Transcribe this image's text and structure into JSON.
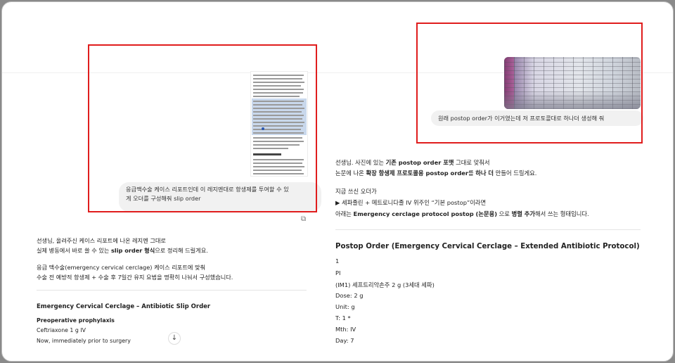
{
  "left_chat": {
    "user_message_line1": "응급맥수술 케이스 리포트인데 이 레지멘대로 항생제를 투여할 수 있",
    "user_message_line2": "게 오더를 구성해줘 slip order",
    "reply_p1_line1": "선생님, 올려주신 케이스 리포트에 나온 레지멘 그대로",
    "reply_p1_line2_pre": "실제 병동에서 바로 쓸 수 있는 ",
    "reply_p1_line2_bold": "slip order 형식",
    "reply_p1_line2_post": "으로 정리해 드릴게요.",
    "reply_p2_line1": "응급 맥수술(emergency cervical cerclage) 케이스 리포트에 맞춰",
    "reply_p2_line2": "수술 전 예방적 항생제 + 수술 후 7일간 유지 요법을 명확히 나눠서 구성했습니다.",
    "order_heading": "Emergency Cervical Cerclage – Antibiotic Slip Order",
    "section_title": "Preoperative prophylaxis",
    "items": [
      "Ceftriaxone 1 g IV",
      "Now, immediately prior to surgery"
    ],
    "scroll_icon": "arrow-down-icon"
  },
  "right_chat": {
    "user_message": "원래 postop order가 이거였는데 저 프로토콜대로 하나더 생성해 줘",
    "p1_line1_pre": "선생님. 사진에 있는 ",
    "p1_line1_bold": "기존 postop order 포맷",
    "p1_line1_post": " 그대로 맞춰서",
    "p1_line2_pre": "논문에 나온 ",
    "p1_line2_bold1": "확장 항생제 프로토콜용 postop order",
    "p1_line2_mid": "를 ",
    "p1_line2_bold2": "하나 더",
    "p1_line2_post": " 만들어 드릴게요.",
    "p2_line1": "지금 쓰신 오더가",
    "p2_line2": "▶ 세파졸린 + 메트로니다졸 IV 위주인 “기본 postop”이라면",
    "p2_line3_pre": "아래는 ",
    "p2_line3_bold1": "Emergency cerclage protocol postop (논문용)",
    "p2_line3_mid": " 으로 ",
    "p2_line3_bold2": "병렬 추가",
    "p2_line3_post": "해서 쓰는 형태입니다.",
    "order_heading": "Postop Order (Emergency Cervical Cerclage – Extended Antibiotic Protocol)",
    "order_rows": [
      "1",
      "PI",
      "(IM1) 세프트리악손주 2 g (3세대 세파)",
      "Dose: 2 g",
      "Unit: g",
      "T: 1 *",
      "Mth: IV",
      "Day: 7"
    ]
  }
}
